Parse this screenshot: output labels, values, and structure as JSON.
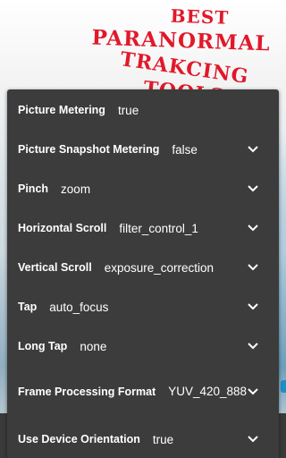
{
  "overlay_title": {
    "line1": "BEST",
    "line2": "PARANORMAL",
    "line3": "TRAKCING",
    "line4": "TOOLS !"
  },
  "settings": [
    {
      "label": "Picture Metering",
      "value": "true",
      "has_dropdown": false
    },
    {
      "label": "Picture Snapshot Metering",
      "value": "false",
      "has_dropdown": true
    },
    {
      "label": "Pinch",
      "value": "zoom",
      "has_dropdown": true
    },
    {
      "label": "Horizontal Scroll",
      "value": "filter_control_1",
      "has_dropdown": true
    },
    {
      "label": "Vertical Scroll",
      "value": "exposure_correction",
      "has_dropdown": true
    },
    {
      "label": "Tap",
      "value": "auto_focus",
      "has_dropdown": true
    },
    {
      "label": "Long Tap",
      "value": "none",
      "has_dropdown": true
    },
    {
      "label": "Frame Processing Format",
      "value": "YUV_420_888",
      "has_dropdown": true
    },
    {
      "label": "Use Device Orientation",
      "value": "true",
      "has_dropdown": true
    }
  ],
  "colors": {
    "panel": "#3c3c3c",
    "text": "#ffffff",
    "title": "#e0192a"
  },
  "icons": {
    "dropdown": "chevron-down-icon"
  }
}
